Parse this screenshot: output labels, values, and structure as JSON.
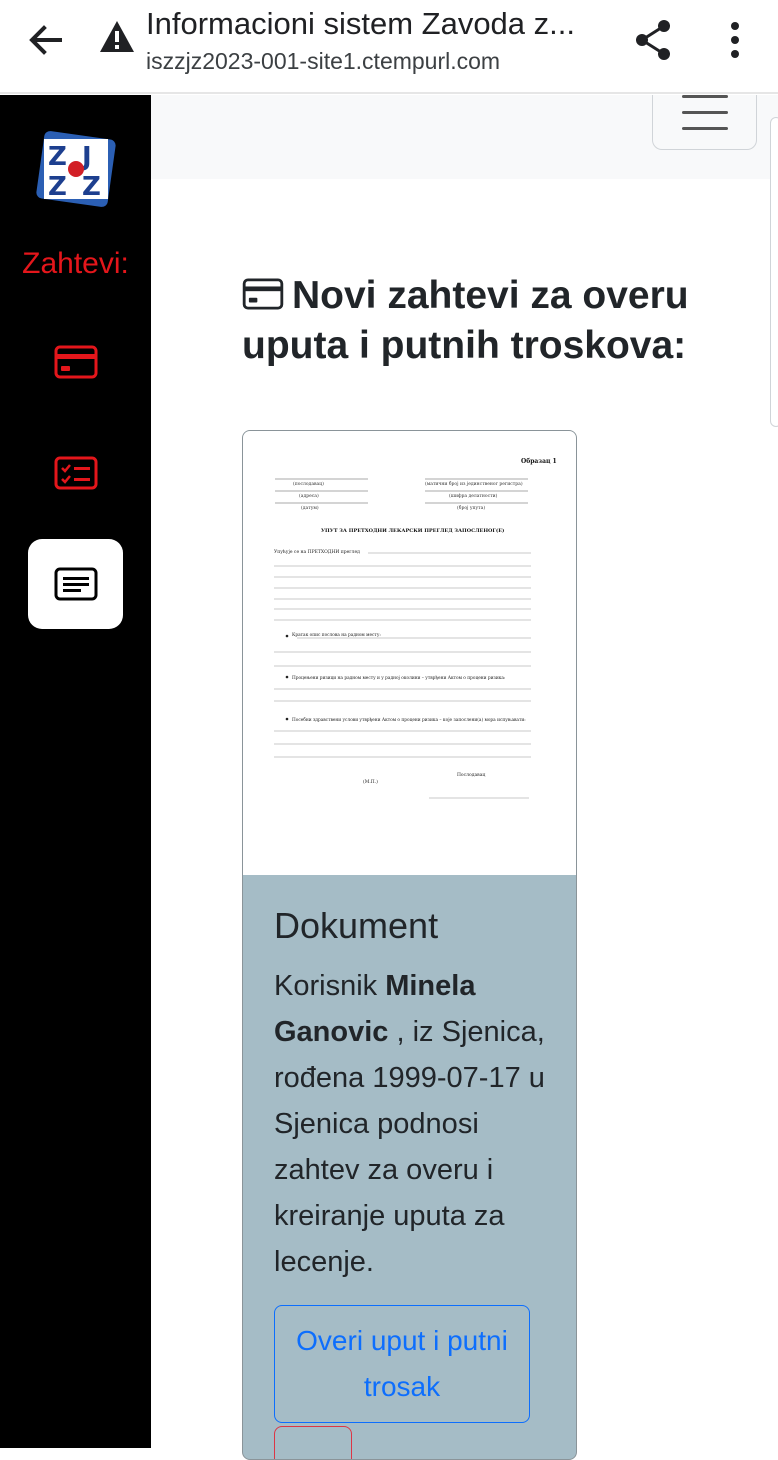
{
  "browser": {
    "title": "Informacioni sistem Zavoda z...",
    "url": "iszzjz2023-001-site1.ctempurl.com"
  },
  "icons": {
    "back": "arrow-left-icon",
    "warning": "warning-triangle-icon",
    "share": "share-icon",
    "more": "more-vertical-icon",
    "menu": "hamburger-icon",
    "card": "credit-card-icon",
    "checklist": "checklist-icon",
    "document": "document-lines-icon"
  },
  "sidebar": {
    "logo_text": "ZJZZ",
    "heading": "Zahtevi:",
    "items": [
      {
        "icon": "credit-card-icon",
        "active": false
      },
      {
        "icon": "checklist-icon",
        "active": false
      },
      {
        "icon": "document-lines-icon",
        "active": true
      }
    ]
  },
  "main": {
    "heading": "Novi zahtevi za overu uputa i putnih troskova:",
    "card": {
      "title": "Dokument",
      "text_prefix": "Korisnik ",
      "user_name": "Minela Ganovic",
      "text_suffix": " , iz Sjenica, rođena 1999-07-17 u Sjenica podnosi zahtev za overu i kreiranje uputa za lecenje.",
      "approve_label": "Overi uput i putni trosak"
    },
    "document_image": {
      "form_label": "Образац 1",
      "sig_lines": [
        "(послодавац)",
        "(адреса)",
        "(датум)"
      ],
      "reg_lines": [
        "(матични број из јединственог регистра)",
        "(шифра делатности)",
        "(број упута)"
      ],
      "title": "УПУТ ЗА ПРЕТХОДНИ ЛЕКАРСКИ ПРЕГЛЕД ЗАПОСЛЕНОГ(Е)",
      "para": "Упућује се на ПРЕТХОДНИ преглед",
      "bullet1": "Кратак опис послова на радном месту:",
      "bullet2": "Процењени ризици на радном месту и у радној околини – утврђени Актом о процени ризика:",
      "bullet3": "Посебни здравствени услови утврђени Актом о процени ризика – које запослени(а) мора испуњавати:",
      "stamp": "(М.П.)",
      "employer": "Послодавац"
    }
  },
  "colors": {
    "sidebar_bg": "#000000",
    "accent_red": "#e4161b",
    "card_bg": "#a5bcc6",
    "primary_blue": "#0d6efd",
    "danger_red": "#dc3545"
  }
}
